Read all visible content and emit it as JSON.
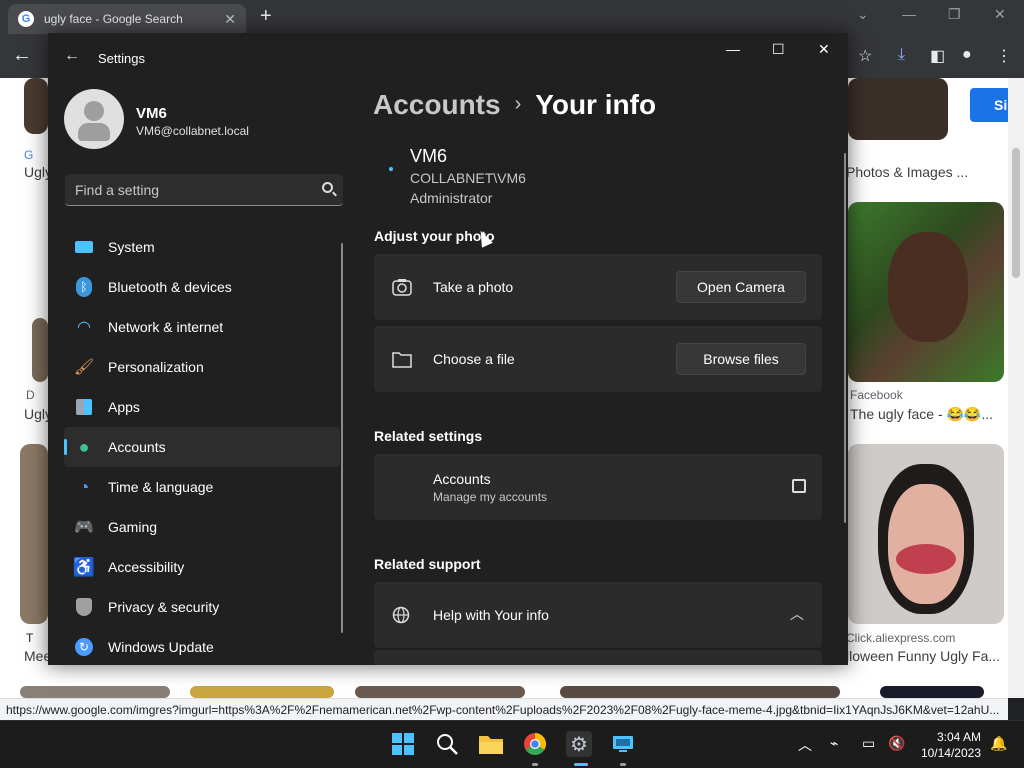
{
  "browser": {
    "tab_title": "ugly face - Google Search",
    "sign_in_label": "Si",
    "status_url": "https://www.google.com/imgres?imgurl=https%3A%2F%2Fnemamerican.net%2Fwp-content%2Fuploads%2F2023%2F08%2Fugly-face-meme-4.jpg&tbnid=Iix1YAqnJsJ6KM&vet=12ahU...",
    "results": {
      "left_source_1": "G",
      "left_title_1": "Ugly",
      "left_source_2": "D",
      "left_title_2": "Ugly",
      "left_source_3": "T",
      "left_title_3": "Mee",
      "right_title_top": "Photos & Images ...",
      "right_source_1": "Facebook",
      "right_title_1": "The ugly face - 😂😂...",
      "right_source_2": "Click.aliexpress.com",
      "right_title_2": "lloween Funny Ugly Fa..."
    }
  },
  "settings": {
    "window_title": "Settings",
    "user": {
      "name": "VM6",
      "email": "VM6@collabnet.local"
    },
    "search_placeholder": "Find a setting",
    "nav": [
      {
        "label": "System",
        "icon": "monitor-icon",
        "color": "#4cc2ff"
      },
      {
        "label": "Bluetooth & devices",
        "icon": "bluetooth-icon",
        "color": "#3a96dd"
      },
      {
        "label": "Network & internet",
        "icon": "wifi-icon",
        "color": "#4cc2ff"
      },
      {
        "label": "Personalization",
        "icon": "brush-icon",
        "color": "#e8a25c"
      },
      {
        "label": "Apps",
        "icon": "apps-icon",
        "color": "#9aa6b5"
      },
      {
        "label": "Accounts",
        "icon": "person-icon",
        "color": "#3ec48f"
      },
      {
        "label": "Time & language",
        "icon": "globe-clock-icon",
        "color": "#4c9bff"
      },
      {
        "label": "Gaming",
        "icon": "gamepad-icon",
        "color": "#b0b0b0"
      },
      {
        "label": "Accessibility",
        "icon": "accessibility-icon",
        "color": "#4cc2ff"
      },
      {
        "label": "Privacy & security",
        "icon": "shield-icon",
        "color": "#a0a0a0"
      },
      {
        "label": "Windows Update",
        "icon": "update-icon",
        "color": "#4c9bff"
      }
    ],
    "active_nav": "Accounts",
    "breadcrumb": {
      "parent": "Accounts",
      "separator": "›",
      "current": "Your info"
    },
    "account": {
      "name": "VM6",
      "domain": "COLLABNET\\VM6",
      "role": "Administrator"
    },
    "adjust_photo": {
      "heading": "Adjust your photo",
      "take_photo_label": "Take a photo",
      "open_camera_label": "Open Camera",
      "choose_file_label": "Choose a file",
      "browse_files_label": "Browse files"
    },
    "related_settings": {
      "heading": "Related settings",
      "accounts_title": "Accounts",
      "accounts_subtitle": "Manage my accounts"
    },
    "related_support": {
      "heading": "Related support",
      "help_label": "Help with Your info"
    }
  },
  "taskbar": {
    "time": "3:04 AM",
    "date": "10/14/2023"
  }
}
